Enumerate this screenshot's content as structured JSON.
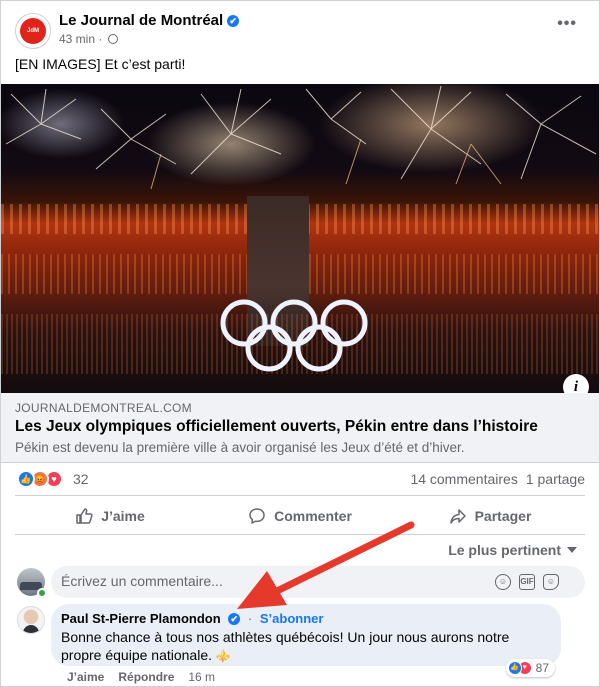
{
  "post": {
    "page_name": "Le Journal de Montréal",
    "verified_mark": "✔",
    "time": "43 min",
    "separator": "·",
    "audience_icon": "globe-icon",
    "more_label": "•••",
    "text": "[EN IMAGES] Et c’est parti!",
    "avatar_logo_text": "JOURNAL MONTRÉAL"
  },
  "link": {
    "domain": "JOURNALDEMONTREAL.COM",
    "title": "Les Jeux olympiques officiellement ouverts, Pékin entre dans l’histoire",
    "description": "Pékin est devenu la première ville à avoir organisé les Jeux d’été et d’hiver.",
    "info_label": "i"
  },
  "reactions": {
    "count": "32",
    "types": [
      "like",
      "angry",
      "love"
    ],
    "comments": "14 commentaires",
    "shares": "1 partage"
  },
  "actions": {
    "like": "J’aime",
    "comment": "Commenter",
    "share": "Partager"
  },
  "sort": {
    "label": "Le plus pertinent"
  },
  "composer": {
    "placeholder": "Écrivez un commentaire..."
  },
  "comment": {
    "author": "Paul St-Pierre Plamondon",
    "follow": "S’abonner",
    "text": "Bonne chance à tous nos athlètes québécois! Un jour nous aurons notre propre équipe nationale.",
    "emoji": "⚜️",
    "reaction_count": "87",
    "like": "J’aime",
    "reply": "Répondre",
    "time": "16 m"
  },
  "colors": {
    "accent": "#1877f2",
    "annotation_arrow": "#e53a2b",
    "comment_bubble": "#e9eef7"
  }
}
